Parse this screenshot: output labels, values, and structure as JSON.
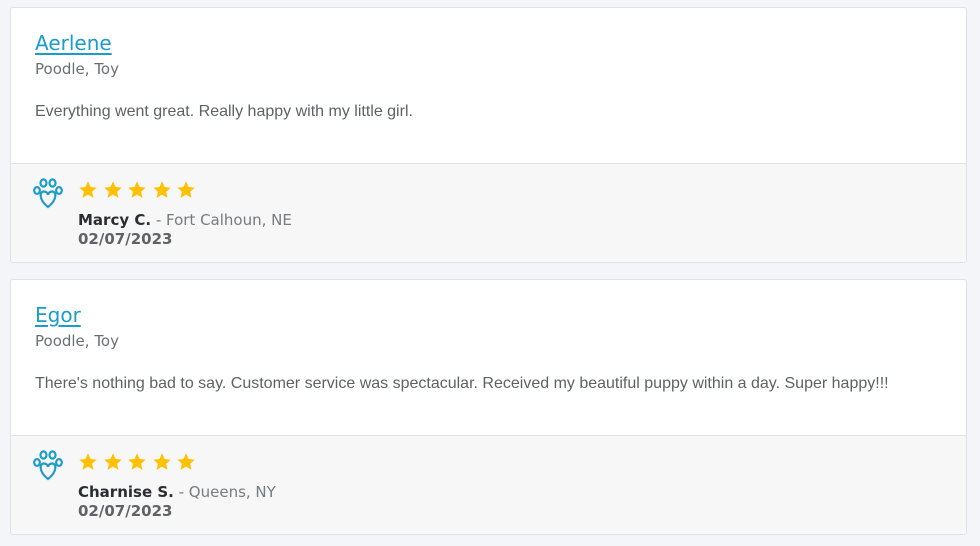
{
  "colors": {
    "accent": "#1c9cc8",
    "star": "#ffc107",
    "background": "#f3f5f8"
  },
  "reviews": [
    {
      "puppy_name": "Aerlene",
      "breed": "Poodle, Toy",
      "text": "Everything went great. Really happy with my little girl.",
      "rating": 5,
      "reviewer": "Marcy C.",
      "location": " - Fort Calhoun, NE",
      "date": "02/07/2023",
      "icon": "paw-heart-icon"
    },
    {
      "puppy_name": "Egor",
      "breed": "Poodle, Toy",
      "text": "There's nothing bad to say. Customer service was spectacular. Received my beautiful puppy within a day. Super happy!!!",
      "rating": 5,
      "reviewer": "Charnise S.",
      "location": " - Queens, NY",
      "date": "02/07/2023",
      "icon": "paw-heart-icon"
    }
  ]
}
